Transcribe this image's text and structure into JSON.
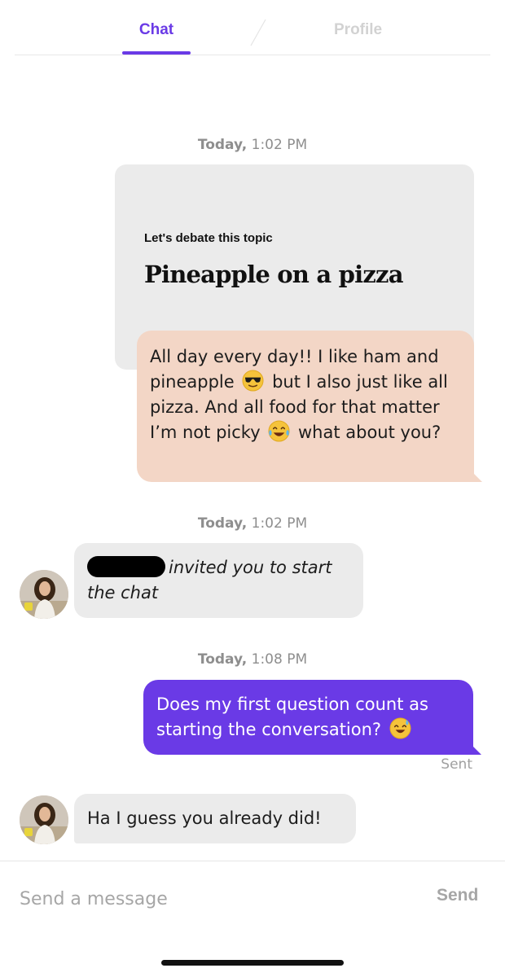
{
  "tabs": {
    "chat": "Chat",
    "profile": "Profile"
  },
  "timestamps": [
    {
      "day": "Today,",
      "time": "1:02 PM"
    },
    {
      "day": "Today,",
      "time": "1:02 PM"
    },
    {
      "day": "Today,",
      "time": "1:08 PM"
    }
  ],
  "topic_card": {
    "label": "Let's debate this topic",
    "title": "Pineapple on a pizza"
  },
  "messages": {
    "reply": {
      "part1": "All day every day!! I like ham and pineapple",
      "part2": "but I also just like all pizza. And all food for that matter I’m not picky",
      "part3": "what about you?"
    },
    "invite": {
      "text": "invited you to start the chat"
    },
    "question": {
      "text": "Does my first question count as starting the conversation?",
      "status": "Sent"
    },
    "answer": {
      "text": "Ha I guess you already did!"
    }
  },
  "icons": {
    "emoji_1": "sunglasses-emoji-icon",
    "emoji_2": "tears-of-joy-emoji-icon",
    "emoji_3": "sweat-smile-emoji-icon"
  },
  "colors": {
    "accent": "#6a3ae6",
    "peach": "#f3d6c6",
    "grey_bubble": "#ebebeb"
  },
  "composer": {
    "placeholder": "Send a message",
    "send_label": "Send"
  }
}
